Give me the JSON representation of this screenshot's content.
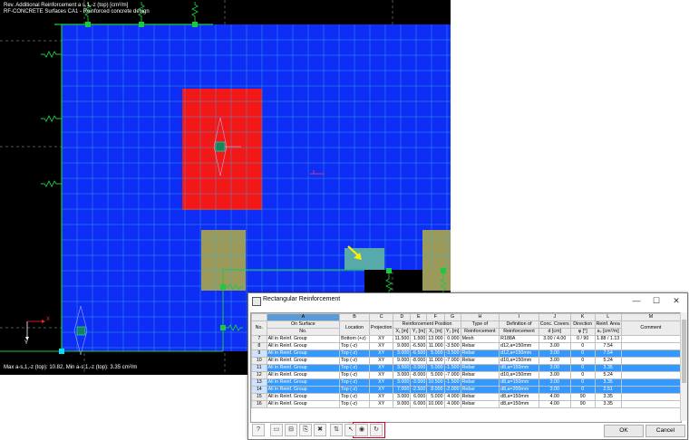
{
  "viewport": {
    "line1": "Rev. Additional Reinforcement a s,1,-z (top) [cm²/m]",
    "line2": "RF-CONCRETE Surfaces CA1 - Reinforced concrete design",
    "status": "Max a-s,1,-z (top): 10.82, Min a-s,1,-z (top): 3.35 cm²/m",
    "axis_x": "X",
    "axis_y": "Y",
    "colors": {
      "background": "#000000",
      "plate": "#0f2ef5",
      "grid": "#40b0e0",
      "red_zone": "#f21818",
      "olive_zone": "#9c9a5a",
      "teal_zone": "#57aaa8",
      "support": "#1ec840"
    }
  },
  "dialog": {
    "title": "Rectangular Reinforcement",
    "close_glyph": "✕",
    "maximize_glyph": "☐",
    "minimize_glyph": "—",
    "col_letters": [
      "A",
      "B",
      "C",
      "D",
      "E",
      "F",
      "G",
      "H",
      "I",
      "J",
      "K",
      "L",
      "M"
    ],
    "group_headers": {
      "on_surface": "On Surface",
      "reinf_position": "Reinforcement Position"
    },
    "headers": {
      "no": "No.",
      "on_surface_no": "No.",
      "location": "Location",
      "projection": "Projection",
      "x1": "X₁ [m]",
      "y1": "Y₁ [m]",
      "x2": "X₂ [m]",
      "y2": "Y₂ [m]",
      "type1": "Type of",
      "type2": "Reinforcement",
      "def1": "Definition of",
      "def2": "Reinforcement",
      "cover1": "Conc. Covers",
      "cover2": "d [cm]",
      "dir1": "Direction",
      "dir2": "φ [°]",
      "area1": "Reinf. Area",
      "area2": "aₛ [cm²/m]",
      "comment": "Comment"
    },
    "rows": [
      {
        "no": "7",
        "surface": "All in Reinf. Group",
        "location": "Bottom (+z)",
        "projection": "XY",
        "x1": "11.500",
        "y1": "1.500",
        "x2": "13.000",
        "y2": "0.000",
        "type": "Mesh",
        "def": "R188A",
        "cover": "3.00 / 4.00",
        "dir": "0 / 90",
        "area": "1.88 / 1.13",
        "sel": false
      },
      {
        "no": "8",
        "surface": "All in Reinf. Group",
        "location": "Top (-z)",
        "projection": "XY",
        "x1": "9.000",
        "y1": "-6.500",
        "x2": "11.000",
        "y2": "-3.500",
        "type": "Rebar",
        "def": "d12,a=150mm",
        "cover": "3.00",
        "dir": "0",
        "area": "7.54",
        "sel": false
      },
      {
        "no": "9",
        "surface": "All in Reinf. Group",
        "location": "Top (-z)",
        "projection": "XY",
        "x1": "3.000",
        "y1": "-6.500",
        "x2": "5.000",
        "y2": "-3.500",
        "type": "Rebar",
        "def": "d12,a=150mm",
        "cover": "3.00",
        "dir": "0",
        "area": "7.54",
        "sel": true
      },
      {
        "no": "10",
        "surface": "All in Reinf. Group",
        "location": "Top (-z)",
        "projection": "XY",
        "x1": "9.000",
        "y1": "-8.000",
        "x2": "11.000",
        "y2": "-7.000",
        "type": "Rebar",
        "def": "d10,a=150mm",
        "cover": "3.00",
        "dir": "0",
        "area": "5.24",
        "sel": false
      },
      {
        "no": "11",
        "surface": "All in Reinf. Group",
        "location": "Top (-z)",
        "projection": "XY",
        "x1": "3.500",
        "y1": "-3.000",
        "x2": "5.000",
        "y2": "-1.500",
        "type": "Rebar",
        "def": "d8,a=150mm",
        "cover": "3.00",
        "dir": "0",
        "area": "3.35",
        "sel": true
      },
      {
        "no": "12",
        "surface": "All in Reinf. Group",
        "location": "Top (-z)",
        "projection": "XY",
        "x1": "3.000",
        "y1": "-8.000",
        "x2": "5.000",
        "y2": "-7.000",
        "type": "Rebar",
        "def": "d10,a=150mm",
        "cover": "3.00",
        "dir": "0",
        "area": "5.24",
        "sel": false
      },
      {
        "no": "13",
        "surface": "All in Reinf. Group",
        "location": "Top (-z)",
        "projection": "XY",
        "x1": "3.000",
        "y1": "-3.000",
        "x2": "10.500",
        "y2": "-1.500",
        "type": "Rebar",
        "def": "d8,a=150mm",
        "cover": "3.00",
        "dir": "0",
        "area": "3.35",
        "sel": true
      },
      {
        "no": "14",
        "surface": "All in Reinf. Group",
        "location": "Top (-z)",
        "projection": "XY",
        "x1": "7.000",
        "y1": "-2.500",
        "x2": "8.000",
        "y2": "-2.000",
        "type": "Rebar",
        "def": "d8,a=200mm",
        "cover": "3.00",
        "dir": "0",
        "area": "2.51",
        "sel": true
      },
      {
        "no": "15",
        "surface": "All in Reinf. Group",
        "location": "Top (-z)",
        "projection": "XY",
        "x1": "3.000",
        "y1": "6.000",
        "x2": "5.000",
        "y2": "4.000",
        "type": "Rebar",
        "def": "d8,a=150mm",
        "cover": "4.00",
        "dir": "90",
        "area": "3.35",
        "sel": false
      },
      {
        "no": "16",
        "surface": "All in Reinf. Group",
        "location": "Top (-z)",
        "projection": "XY",
        "x1": "9.000",
        "y1": "6.000",
        "x2": "10.000",
        "y2": "4.000",
        "type": "Rebar",
        "def": "d8,a=150mm",
        "cover": "4.00",
        "dir": "90",
        "area": "3.35",
        "sel": false
      }
    ],
    "toolbar_icons": [
      "help-icon",
      "new-row-icon",
      "insert-row-icon",
      "copy-icon",
      "delete-icon",
      "sort-icon",
      "select-icon",
      "show-icon",
      "refresh-icon"
    ],
    "toolbar_glyphs": [
      "?",
      "▭",
      "⊟",
      "⎘",
      "✖",
      "⇅",
      "↖",
      "◉",
      "↻"
    ],
    "ok_label": "OK",
    "cancel_label": "Cancel"
  }
}
